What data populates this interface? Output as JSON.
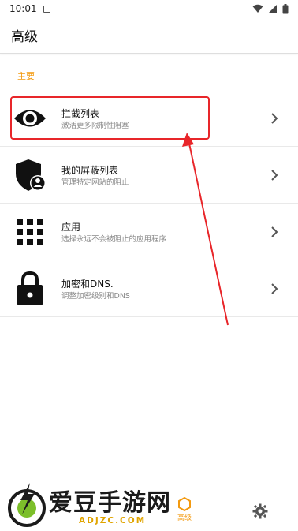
{
  "status_bar": {
    "time": "10:01"
  },
  "app_bar": {
    "title": "高级"
  },
  "section": {
    "header": "主要"
  },
  "rows": [
    {
      "title": "拦截列表",
      "subtitle": "激活更多限制性阻塞",
      "icon": "eye-icon"
    },
    {
      "title": "我的屏蔽列表",
      "subtitle": "管理特定网站的阻止",
      "icon": "shield-user-icon"
    },
    {
      "title": "应用",
      "subtitle": "选择永远不会被阻止的应用程序",
      "icon": "grid-icon"
    },
    {
      "title": "加密和DNS.",
      "subtitle": "调整加密级别和DNS",
      "icon": "lock-icon"
    }
  ],
  "bottom_nav": {
    "active_label": "高级"
  },
  "watermark": {
    "text": "爱豆手游网",
    "sub": "ADJZC.COM"
  },
  "colors": {
    "accent": "#f39a10",
    "annotation_red": "#e8262a"
  }
}
